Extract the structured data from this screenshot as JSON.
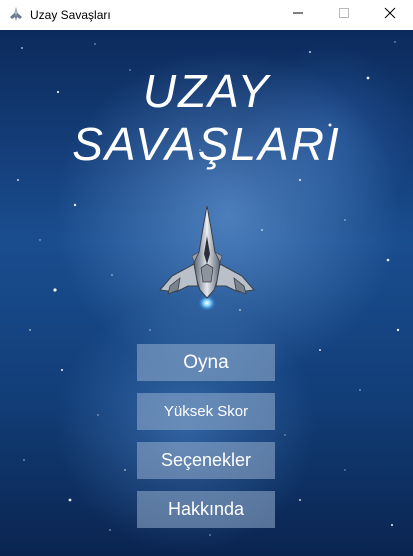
{
  "window": {
    "title": "Uzay Savaşları",
    "icon": "spaceship-icon",
    "controls": [
      "minimize-icon",
      "maximize-icon",
      "close-icon"
    ]
  },
  "game": {
    "title_line1": "UZAY",
    "title_line2": "SAVAŞLARI",
    "ship_icon": "spaceship-icon"
  },
  "menu": {
    "play_label": "Oyna",
    "high_score_label": "Yüksek Skor",
    "options_label": "Seçenekler",
    "about_label": "Hakkında"
  },
  "colors": {
    "background_dark": "#0c2a5c",
    "background_mid": "#1a4d8f",
    "button_fill": "#96afcd",
    "text": "#ffffff"
  }
}
